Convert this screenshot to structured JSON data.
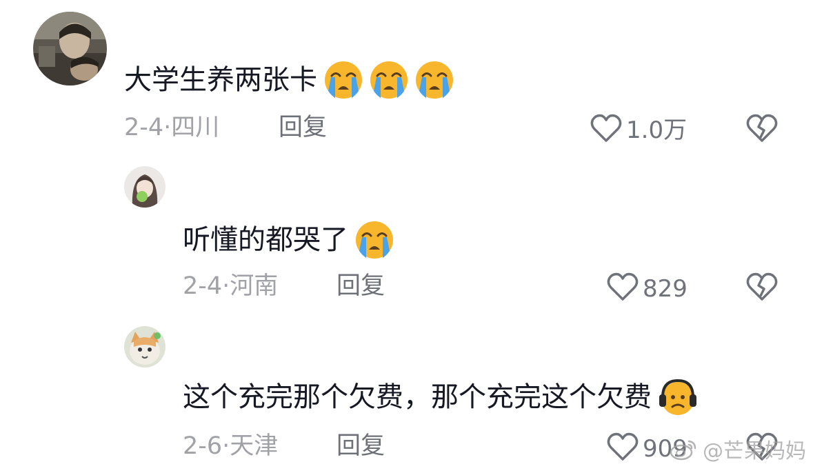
{
  "comments": [
    {
      "text": "大学生养两张卡",
      "emojis": [
        "loudly-crying-face",
        "loudly-crying-face",
        "loudly-crying-face"
      ],
      "date": "2-4·",
      "location": "四川",
      "reply_label": "回复",
      "likes": "1.0万"
    },
    {
      "text": "听懂的都哭了",
      "emojis": [
        "loudly-crying-face"
      ],
      "date": "2-4·",
      "location": "河南",
      "reply_label": "回复",
      "likes": "829"
    },
    {
      "text": "这个充完那个欠费，那个充完这个欠费",
      "emojis": [
        "headphones-sad-face"
      ],
      "date": "2-6·",
      "location": "天津",
      "reply_label": "回复",
      "likes": "909"
    }
  ],
  "watermark": {
    "text": "@芒果妈妈",
    "icon": "weibo-icon"
  },
  "colors": {
    "text_primary": "#161823",
    "text_meta": "#a1a2a7",
    "text_reply": "#6e7078",
    "icon": "#70727a"
  }
}
